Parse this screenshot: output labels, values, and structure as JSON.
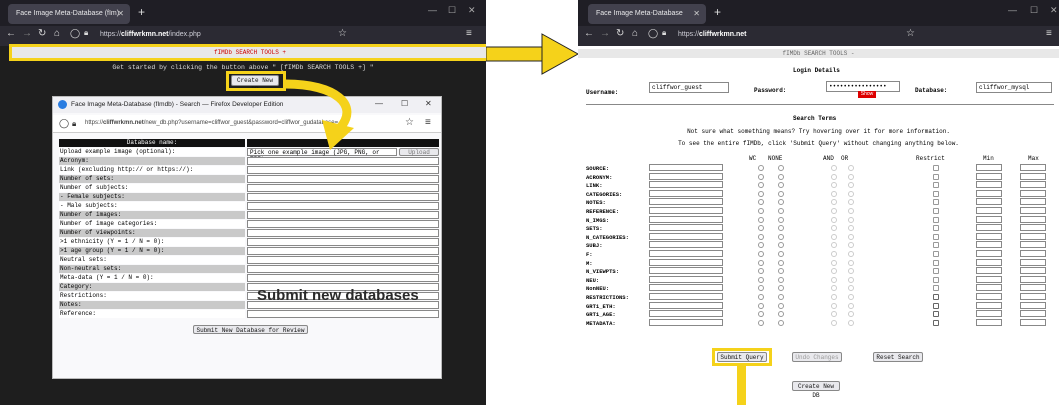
{
  "left_window": {
    "tab_title": "Face Image Meta-Database (fIm)",
    "url_prefix": "https://",
    "url_domain": "cliffwrkmn.net",
    "url_path": "/index.php",
    "menu_bar": "fIMDb SEARCH TOOLS +",
    "intro_text": "Get started by clicking the button above \" [fIMDb SEARCH TOOLS +] \"",
    "create_db_button": "Create New DB"
  },
  "popup": {
    "title": "Face Image Meta-Database (fImdb) - Search — Firefox Developer Edition",
    "url_prefix": "https://",
    "url_domain": "cliffwrkmn.net",
    "url_path": "/new_db.php?username=cliffwor_guest&password=cliffwor_gu",
    "url_tail": "database=",
    "header": "Database name:",
    "rows": [
      {
        "label": "Upload example image (optional):",
        "value": "Pick one example image (JPG, PNG, or TIF)",
        "extra": "Upload"
      },
      {
        "label": "Acronym:",
        "value": "",
        "extra": ""
      },
      {
        "label": "Link (excluding http:// or https://):",
        "value": "",
        "extra": ""
      },
      {
        "label": "Number of sets:",
        "value": "",
        "extra": ""
      },
      {
        "label": "Number of subjects:",
        "value": "",
        "extra": ""
      },
      {
        "label": "- Female subjects:",
        "value": "",
        "extra": ""
      },
      {
        "label": "- Male subjects:",
        "value": "",
        "extra": ""
      },
      {
        "label": "Number of images:",
        "value": "",
        "extra": ""
      },
      {
        "label": "Number of image categories:",
        "value": "",
        "extra": ""
      },
      {
        "label": "Number of viewpoints:",
        "value": "",
        "extra": ""
      },
      {
        "label": ">1 ethnicity (Y = 1 / N = 0):",
        "value": "",
        "extra": ""
      },
      {
        "label": ">1 age group (Y = 1 / N = 0):",
        "value": "",
        "extra": ""
      },
      {
        "label": "Neutral sets:",
        "value": "",
        "extra": ""
      },
      {
        "label": "Non-neutral sets:",
        "value": "",
        "extra": ""
      },
      {
        "label": "Meta-data (Y = 1 / N = 0):",
        "value": "",
        "extra": ""
      },
      {
        "label": "Category:",
        "value": "",
        "extra": ""
      },
      {
        "label": "Restrictions:",
        "value": "",
        "extra": ""
      },
      {
        "label": "Notes:",
        "value": "",
        "extra": ""
      },
      {
        "label": "Reference:",
        "value": "",
        "extra": ""
      }
    ],
    "submit_button": "Submit New Database for Review"
  },
  "annotation_text": "Submit new databases",
  "right_window": {
    "tab_title": "Face Image Meta-Database (fImdb)",
    "url_prefix": "https://",
    "url_domain": "cliffwrkmn.net",
    "menu_bar": "fIMDb SEARCH TOOLS -",
    "login_title": "Login Details",
    "username_label": "Username:",
    "username_value": "cliffwor_guest",
    "password_label": "Password:",
    "password_value": "••••••••••••••••",
    "password_toggle": "Show",
    "database_label": "Database:",
    "database_value": "cliffwor_mysql",
    "search_title": "Search Terms",
    "hint1": "Not sure what something means? Try hovering over it for more information.",
    "hint2": "To see the entire fIMDb, click 'Submit Query' without changing anything below.",
    "col_headers": [
      "WC",
      "NONE",
      "AND",
      "OR",
      "Restrict",
      "Min",
      "Max"
    ],
    "fields": [
      "SOURCE:",
      "ACRONYM:",
      "LINK:",
      "CATEGORIES:",
      "NOTES:",
      "REFERENCE:",
      "N_IMGS:",
      "SETS:",
      "N_CATEGORIES:",
      "SUBJ:",
      "F:",
      "M:",
      "N_VIEWPTS:",
      "NEU:",
      "NonNEU:",
      "RESTRICTIONS:",
      "GRT1_ETH:",
      "GRT1_AGE:",
      "METADATA:"
    ],
    "submit_query": "Submit Query",
    "undo_changes": "Undo Changes",
    "reset_search": "Reset Search",
    "create_db_button": "Create New DB"
  },
  "colors": {
    "highlight": "#f5d21a",
    "browser_bg": "#2b2a33"
  }
}
